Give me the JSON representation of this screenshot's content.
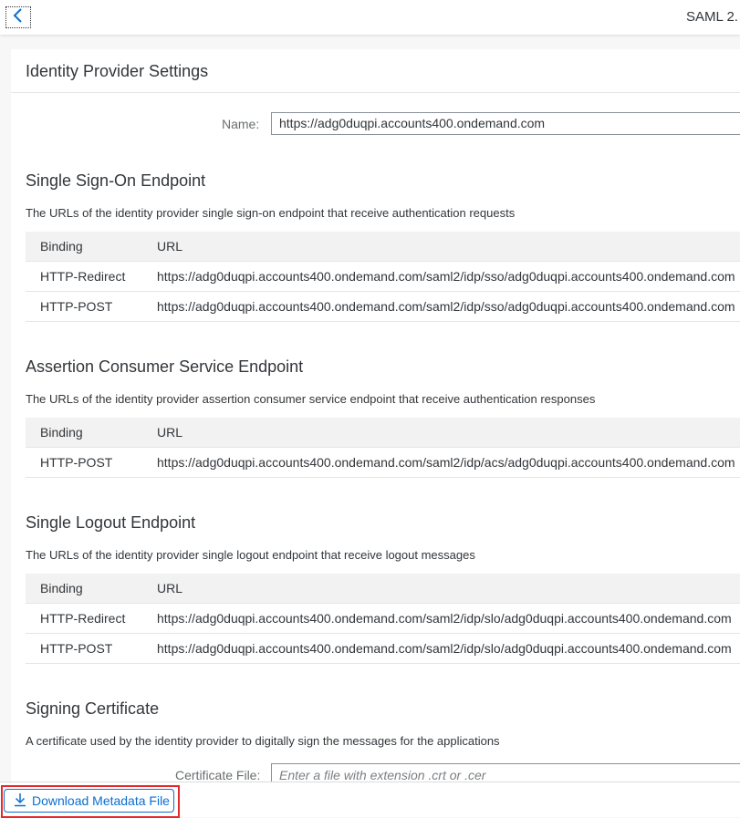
{
  "header": {
    "title": "SAML 2.",
    "back_icon": "chevron-left-icon"
  },
  "panel": {
    "title": "Identity Provider Settings",
    "name_label": "Name:",
    "name_value": "https://adg0duqpi.accounts400.ondemand.com"
  },
  "sso": {
    "title": "Single Sign-On Endpoint",
    "description": "The URLs of the identity provider single sign-on endpoint that receive authentication requests",
    "columns": [
      "Binding",
      "URL"
    ],
    "rows": [
      {
        "binding": "HTTP-Redirect",
        "url": "https://adg0duqpi.accounts400.ondemand.com/saml2/idp/sso/adg0duqpi.accounts400.ondemand.com"
      },
      {
        "binding": "HTTP-POST",
        "url": "https://adg0duqpi.accounts400.ondemand.com/saml2/idp/sso/adg0duqpi.accounts400.ondemand.com"
      }
    ]
  },
  "acs": {
    "title": "Assertion Consumer Service Endpoint",
    "description": "The URLs of the identity provider assertion consumer service endpoint that receive authentication responses",
    "columns": [
      "Binding",
      "URL"
    ],
    "rows": [
      {
        "binding": "HTTP-POST",
        "url": "https://adg0duqpi.accounts400.ondemand.com/saml2/idp/acs/adg0duqpi.accounts400.ondemand.com"
      }
    ]
  },
  "slo": {
    "title": "Single Logout Endpoint",
    "description": "The URLs of the identity provider single logout endpoint that receive logout messages",
    "columns": [
      "Binding",
      "URL"
    ],
    "rows": [
      {
        "binding": "HTTP-Redirect",
        "url": "https://adg0duqpi.accounts400.ondemand.com/saml2/idp/slo/adg0duqpi.accounts400.ondemand.com"
      },
      {
        "binding": "HTTP-POST",
        "url": "https://adg0duqpi.accounts400.ondemand.com/saml2/idp/slo/adg0duqpi.accounts400.ondemand.com"
      }
    ]
  },
  "signing": {
    "title": "Signing Certificate",
    "description": "A certificate used by the identity provider to digitally sign the messages for the applications",
    "cert_label": "Certificate File:",
    "cert_placeholder": "Enter a file with extension .crt or .cer"
  },
  "footer": {
    "download_label": "Download Metadata File",
    "download_icon": "download-icon"
  },
  "colors": {
    "accent": "#0a6ed1",
    "highlight": "#e52929",
    "text": "#32363a",
    "table_header_bg": "#f2f2f2"
  }
}
